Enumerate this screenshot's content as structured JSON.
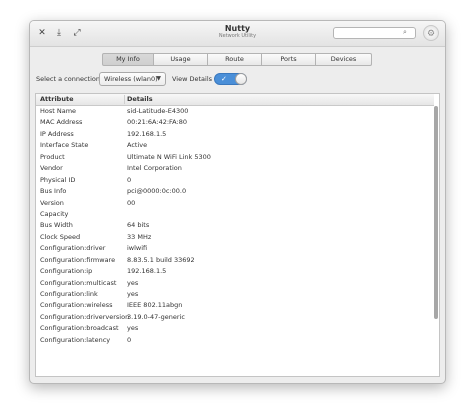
{
  "window": {
    "title": "Nutty",
    "subtitle": "Network Utility",
    "search_placeholder": ""
  },
  "tabs": [
    {
      "label": "My Info",
      "active": true
    },
    {
      "label": "Usage",
      "active": false
    },
    {
      "label": "Route",
      "active": false
    },
    {
      "label": "Ports",
      "active": false
    },
    {
      "label": "Devices",
      "active": false
    }
  ],
  "controls": {
    "connection_label": "Select a connection",
    "connection_value": "Wireless (wlan0)",
    "view_details_label": "View Details",
    "view_details_on": true
  },
  "table": {
    "columns": [
      "Attribute",
      "Details"
    ],
    "rows": [
      [
        "Host Name",
        "sid-Latitude-E4300"
      ],
      [
        "MAC Address",
        "00:21:6A:42:FA:80"
      ],
      [
        "IP Address",
        "192.168.1.5"
      ],
      [
        "Interface State",
        "Active"
      ],
      [
        "Product",
        "Ultimate N WiFi Link 5300"
      ],
      [
        "Vendor",
        "Intel Corporation"
      ],
      [
        "Physical ID",
        "0"
      ],
      [
        "Bus Info",
        "pci@0000:0c:00.0"
      ],
      [
        "Version",
        "00"
      ],
      [
        "Capacity",
        ""
      ],
      [
        "Bus Width",
        "64 bits"
      ],
      [
        "Clock Speed",
        "33 MHz"
      ],
      [
        "Configuration:driver",
        "iwlwifi"
      ],
      [
        "Configuration:firmware",
        "8.83.5.1 build 33692"
      ],
      [
        "Configuration:ip",
        "192.168.1.5"
      ],
      [
        "Configuration:multicast",
        "yes"
      ],
      [
        "Configuration:link",
        "yes"
      ],
      [
        "Configuration:wireless",
        "IEEE 802.11abgn"
      ],
      [
        "Configuration:driverversion",
        "3.19.0-47-generic"
      ],
      [
        "Configuration:broadcast",
        "yes"
      ],
      [
        "Configuration:latency",
        "0"
      ]
    ]
  },
  "colors": {
    "toggle_on": "#4a8fd8",
    "window_bg": "#ededed"
  }
}
